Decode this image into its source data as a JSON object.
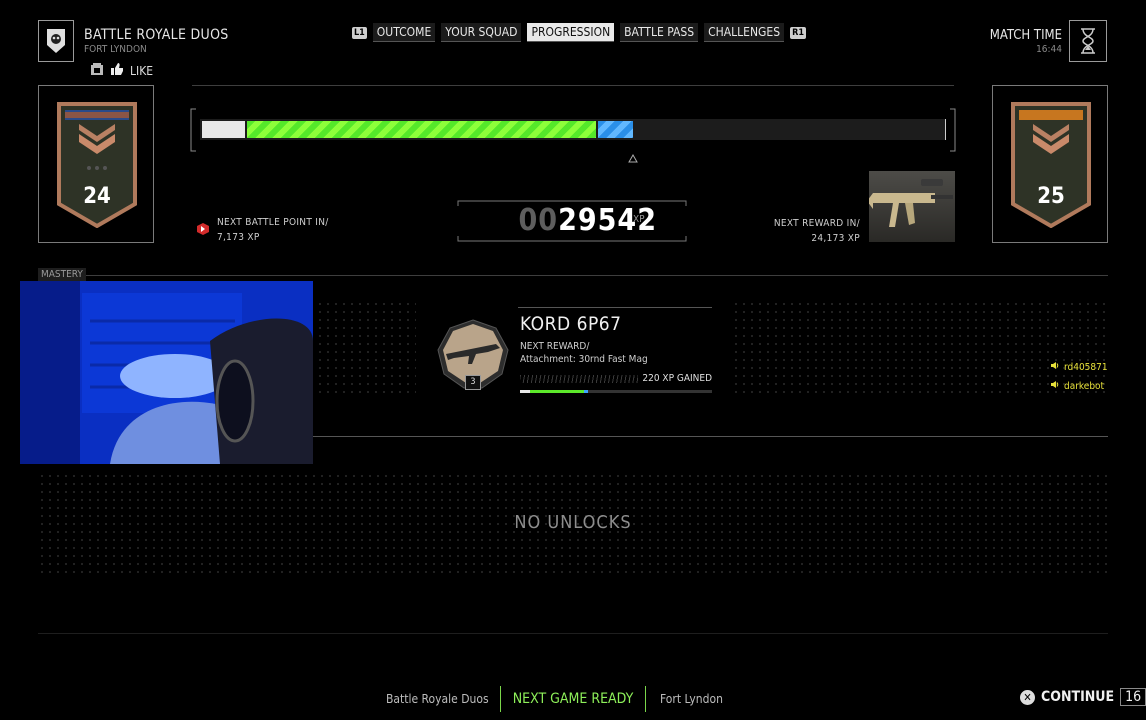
{
  "header": {
    "mode_title": "BATTLE ROYALE DUOS",
    "mode_subtitle": "FORT LYNDON",
    "like_label": "LIKE",
    "tabs_left_key": "L1",
    "tabs_right_key": "R1",
    "tabs": [
      {
        "label": "OUTCOME",
        "active": false
      },
      {
        "label": "YOUR SQUAD",
        "active": false
      },
      {
        "label": "PROGRESSION",
        "active": true
      },
      {
        "label": "BATTLE PASS",
        "active": false
      },
      {
        "label": "CHALLENGES",
        "active": false
      }
    ],
    "match_time_label": "MATCH TIME",
    "match_time_value": "16:44"
  },
  "progression": {
    "current_rank": "24",
    "next_rank": "25",
    "bar_fill_segments": {
      "previous": 0.06,
      "gained": 0.47,
      "bonus": 0.05
    },
    "next_battle_point_label": "NEXT BATTLE POINT IN/",
    "next_battle_point_value": "7,173  XP",
    "xp_total_dim": "00",
    "xp_total": "29542",
    "xp_unit": "XP",
    "next_reward_label": "NEXT REWARD IN/",
    "next_reward_value": "24,173 XP"
  },
  "mastery": {
    "section_label": "MASTERY",
    "weapon_name": "KORD 6P67",
    "weapon_level": "3",
    "next_reward_label": "NEXT REWARD/",
    "next_reward_value": "Attachment: 30rnd Fast Mag",
    "xp_gained": "220 XP GAINED",
    "progress_previous": 0.15,
    "progress_gained": 0.28,
    "progress_bonus": 0.02
  },
  "players": [
    "rd405871",
    "darkebot"
  ],
  "unlocks": {
    "empty_text": "NO UNLOCKS"
  },
  "footer": {
    "mode": "Battle Royale Duos",
    "status": "NEXT GAME READY",
    "map": "Fort Lyndon",
    "continue_label": "CONTINUE",
    "countdown": "16"
  },
  "colors": {
    "xp_green": "#6cf52f",
    "bonus_blue": "#3ea5ff",
    "status_green": "#8ef05a",
    "player_yellow": "#e7e13a"
  }
}
